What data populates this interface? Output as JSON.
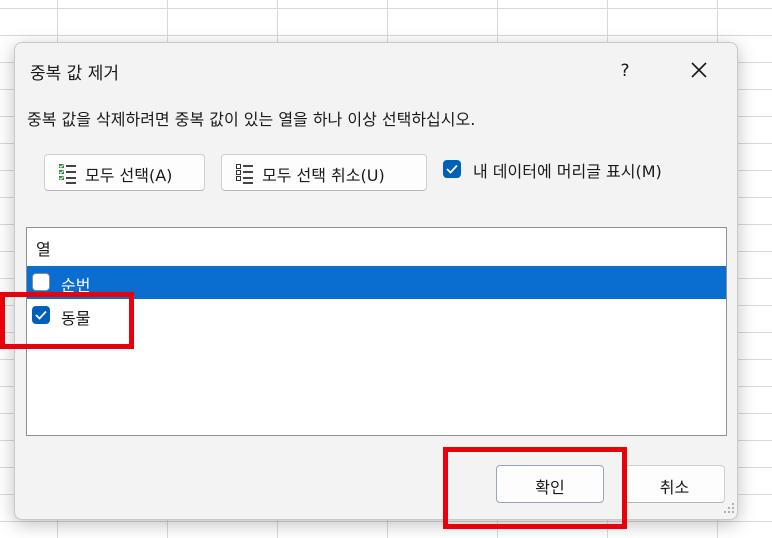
{
  "dialog": {
    "title": "중복 값 제거",
    "help_label": "?",
    "instruction": "중복 값을 삭제하려면 중복 값이 있는 열을 하나 이상 선택하십시오.",
    "select_all_label": "모두 선택(A)",
    "unselect_all_label": "모두 선택 취소(U)",
    "header_checkbox_label": "내 데이터에 머리글 표시(M)",
    "header_checkbox_checked": true,
    "list_header": "열",
    "columns": [
      {
        "label": "순번",
        "checked": false,
        "selected": true
      },
      {
        "label": "동물",
        "checked": true,
        "selected": false
      }
    ],
    "ok_label": "확인",
    "cancel_label": "취소"
  },
  "colors": {
    "accent": "#005fb8",
    "selection": "#0a6ed1",
    "annotation": "#e8000b"
  },
  "icons": [
    "close-icon",
    "select-all-icon",
    "unselect-all-icon",
    "checkmark-icon",
    "resize-grip-icon"
  ]
}
